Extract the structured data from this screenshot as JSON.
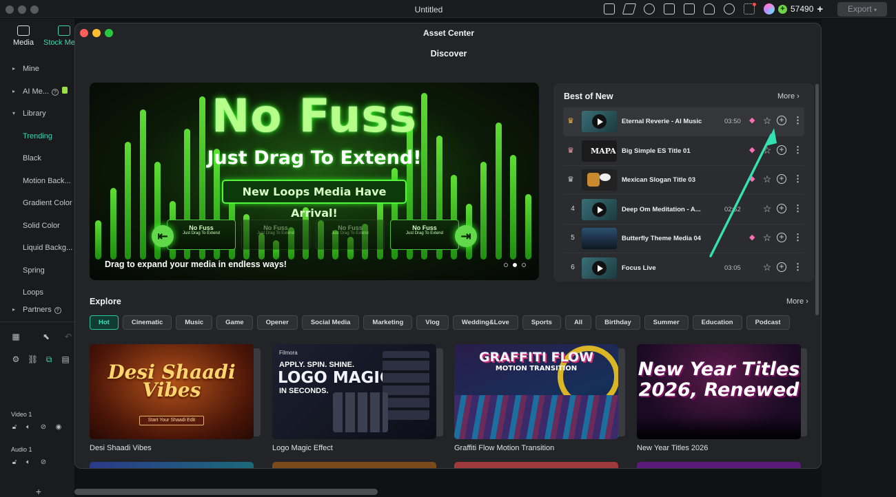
{
  "app": {
    "title": "Untitled",
    "credits": "57490",
    "export_label": "Export",
    "coin_symbol": "+",
    "add_symbol": "+"
  },
  "left_panel": {
    "tabs": [
      {
        "label": "Media",
        "icon": "media-icon"
      },
      {
        "label": "Stock Me",
        "icon": "stock-media-icon"
      }
    ],
    "items": [
      {
        "label": "Mine",
        "arrow": "▸"
      },
      {
        "label": "AI Me...",
        "arrow": "▸"
      },
      {
        "label": "Library",
        "arrow": "▾"
      },
      {
        "label": "Trending"
      },
      {
        "label": "Black"
      },
      {
        "label": "Motion Back..."
      },
      {
        "label": "Gradient Color"
      },
      {
        "label": "Solid Color"
      },
      {
        "label": "Liquid Backg..."
      },
      {
        "label": "Spring"
      },
      {
        "label": "Loops"
      },
      {
        "label": "Partners",
        "arrow": "▸"
      }
    ],
    "help_glyph": "?",
    "tracks": {
      "video": "Video 1",
      "audio": "Audio 1"
    }
  },
  "asset_center": {
    "window_title": "Asset Center",
    "heading": "Discover",
    "banner": {
      "title": "No Fuss",
      "subtitle": "Just Drag To Extend!",
      "pill": "New Loops Media Have Arrival!",
      "thumb_title": "No Fuss",
      "thumb_sub": "Just Drag To Extend",
      "caption": "Drag to expand your media in endless ways!",
      "slide_index": 2,
      "slide_count": 3
    },
    "best_of_new": {
      "title": "Best of New",
      "more": "More ›",
      "rows": [
        {
          "rank": "crown",
          "name": "Eternal Reverie - AI Music",
          "duration": "03:50",
          "premium": true
        },
        {
          "rank": "crown",
          "name": "Big Simple ES Title 01",
          "duration": "",
          "premium": true
        },
        {
          "rank": "crown",
          "name": "Mexican Slogan Title 03",
          "duration": "",
          "premium": true
        },
        {
          "rank": "4",
          "name": "Deep Om Meditation - A...",
          "duration": "02:52",
          "premium": false
        },
        {
          "rank": "5",
          "name": "Butterfly Theme Media 04",
          "duration": "",
          "premium": true
        },
        {
          "rank": "6",
          "name": "Focus Live",
          "duration": "03:05",
          "premium": false
        }
      ],
      "thumb_text": {
        "mapa": "MAPA"
      }
    },
    "explore": {
      "title": "Explore",
      "more": "More ›",
      "chips": [
        "Hot",
        "Cinematic",
        "Music",
        "Game",
        "Opener",
        "Social Media",
        "Marketing",
        "Vlog",
        "Wedding&Love",
        "Sports",
        "All",
        "Birthday",
        "Summer",
        "Education",
        "Podcast"
      ],
      "cards": [
        {
          "label": "Desi Shaadi Vibes",
          "art": "Desi Shaadi Vibes",
          "button": "Start Your Shaadi Edit"
        },
        {
          "label": "Logo Magic Effect",
          "art": "LOGO MAGIC",
          "brand": "Filmora",
          "tag": "APPLY. SPIN. SHINE.",
          "sub": "IN SECONDS."
        },
        {
          "label": "Graffiti Flow Motion Transition",
          "art": "GRAFFITI FLOW",
          "sub": "MOTION TRANSITION"
        },
        {
          "label": "New Year Titles 2026",
          "art": "New Year Titles 2026, Renewed"
        }
      ]
    }
  }
}
